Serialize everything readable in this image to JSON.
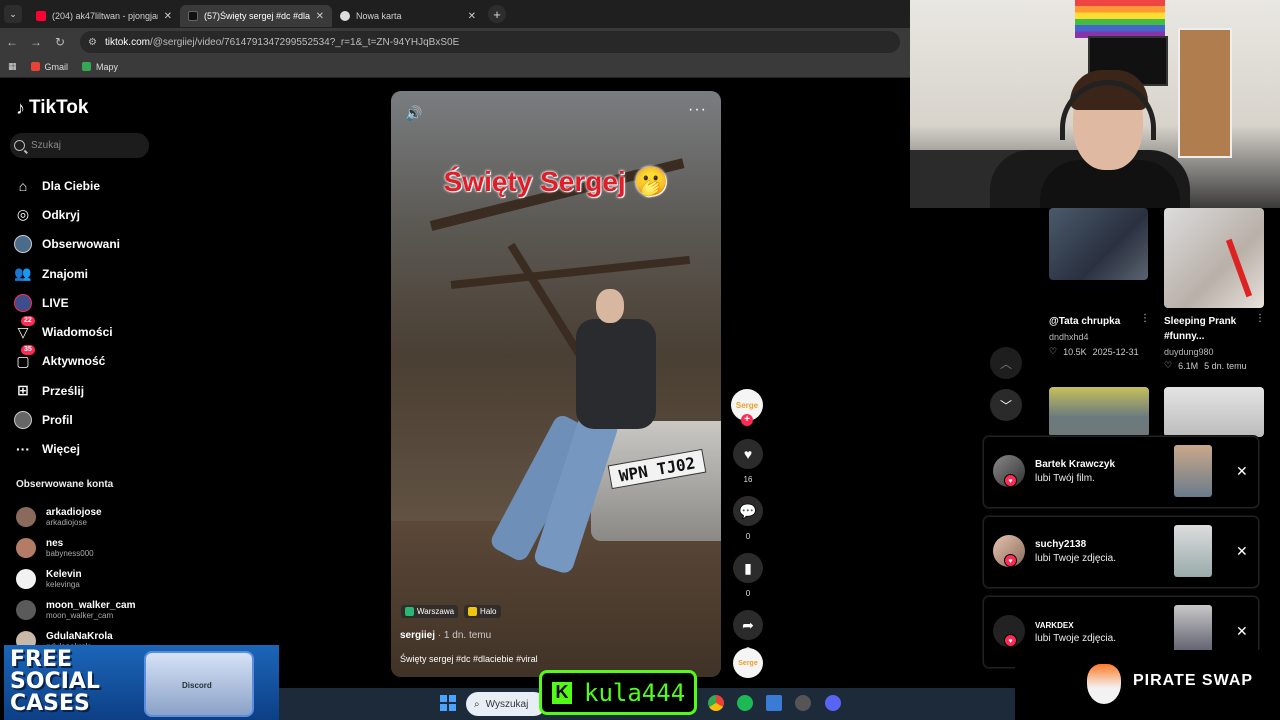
{
  "browser": {
    "menu_glyph": "⌄",
    "tabs": [
      {
        "title": "(204) ak47liltwan - pjongjang -"
      },
      {
        "title": "(57)Święty sergej #dc #dlaciebie"
      },
      {
        "title": "Nowa karta"
      }
    ],
    "new_tab": "+",
    "close": "✕",
    "url_host": "tiktok.com",
    "url_path": "/@sergiiej/video/7614791347299552534?_r=1&_t=ZN-94YHJqBxS0E",
    "bookmarks": [
      "Gmail",
      "Mapy"
    ]
  },
  "tiktok": {
    "logo": "TikTok",
    "search_placeholder": "Szukaj",
    "nav": [
      {
        "label": "Dla Ciebie",
        "icon": "home-icon"
      },
      {
        "label": "Odkryj",
        "icon": "compass-icon"
      },
      {
        "label": "Obserwowani",
        "icon": "avatar-icon"
      },
      {
        "label": "Znajomi",
        "icon": "friends-icon"
      },
      {
        "label": "LIVE",
        "icon": "live-icon"
      },
      {
        "label": "Wiadomości",
        "icon": "messages-icon",
        "badge": "22"
      },
      {
        "label": "Aktywność",
        "icon": "activity-icon",
        "badge": "35"
      },
      {
        "label": "Prześlij",
        "icon": "upload-icon"
      },
      {
        "label": "Profil",
        "icon": "profile-icon"
      },
      {
        "label": "Więcej",
        "icon": "more-icon"
      }
    ],
    "followed_title": "Obserwowane konta",
    "followed": [
      {
        "name": "arkadiojose",
        "handle": "arkadiojose"
      },
      {
        "name": "nes",
        "handle": "babyness000"
      },
      {
        "name": "Kelevin",
        "handle": "kelevinga"
      },
      {
        "name": "moon_walker_cam",
        "handle": "moon_walker_cam"
      },
      {
        "name": "GdulaNaKrola",
        "handle": "gdulanakrola"
      }
    ]
  },
  "video": {
    "overlay_title": "Święty Sergej 🫢",
    "plate": "WPN TJ02",
    "chips": [
      "Warszawa",
      "Halo"
    ],
    "author": "sergiiej",
    "time": " · 1 dn. temu",
    "caption": "Święty sergej #dc #dlaciebie #viral",
    "avatar_text": "Serge",
    "likes": "16",
    "comments": "0",
    "saves": "0",
    "shares": "3"
  },
  "recommended": [
    {
      "title": "@Tata chrupka",
      "user": "dndhxhd4",
      "likes": "10.5K",
      "date": "2025-12-31"
    },
    {
      "title": "Sleeping Prank #funny...",
      "user": "duydung980",
      "likes": "6.1M",
      "date": "5 dn. temu"
    }
  ],
  "notifications": [
    {
      "user": "Bartek Krawczyk",
      "text": "lubi Twój film."
    },
    {
      "user": "suchy2138",
      "text": "lubi Twoje zdjęcia."
    },
    {
      "user": "VARKDEX",
      "text": "lubi Twoje zdjęcia."
    }
  ],
  "overlay": {
    "promo_line1": "FREE",
    "promo_line2": "SOCIAL",
    "promo_line3": "CASES",
    "promo_box": "Discord",
    "kick_user": "kula444",
    "sponsor": "PIRATE SWAP",
    "taskbar_search": "Wyszukaj"
  },
  "colors": {
    "accent": "#fe2c55",
    "kick": "#53fc18"
  }
}
